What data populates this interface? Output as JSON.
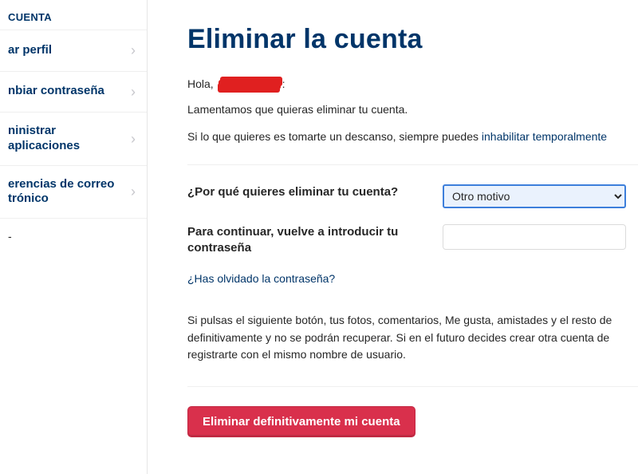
{
  "sidebar": {
    "header": "CUENTA",
    "items": [
      {
        "label": "ar perfil"
      },
      {
        "label": "nbiar contraseña"
      },
      {
        "label": "ninistrar aplicaciones"
      },
      {
        "label": "erencias de correo\ntrónico"
      }
    ],
    "tail": "-"
  },
  "page": {
    "title": "Eliminar la cuenta",
    "greeting_prefix": "Hola, ",
    "greeting_suffix": ":",
    "p1": "Lamentamos que quieras eliminar tu cuenta.",
    "p2a": "Si lo que quieres es tomarte un descanso, siempre puedes ",
    "p2_link": "inhabilitar temporalmente",
    "form": {
      "reason_label": "¿Por qué quieres eliminar tu cuenta?",
      "reason_value": "Otro motivo",
      "password_label": "Para continuar, vuelve a introducir tu contraseña",
      "forgot": "¿Has olvidado la contraseña?"
    },
    "warning": "Si pulsas el siguiente botón, tus fotos, comentarios, Me gusta, amistades y el resto de definitivamente y no se podrán recuperar. Si en el futuro decides crear otra cuenta de registrarte con el mismo nombre de usuario.",
    "delete_button": "Eliminar definitivamente mi cuenta"
  }
}
